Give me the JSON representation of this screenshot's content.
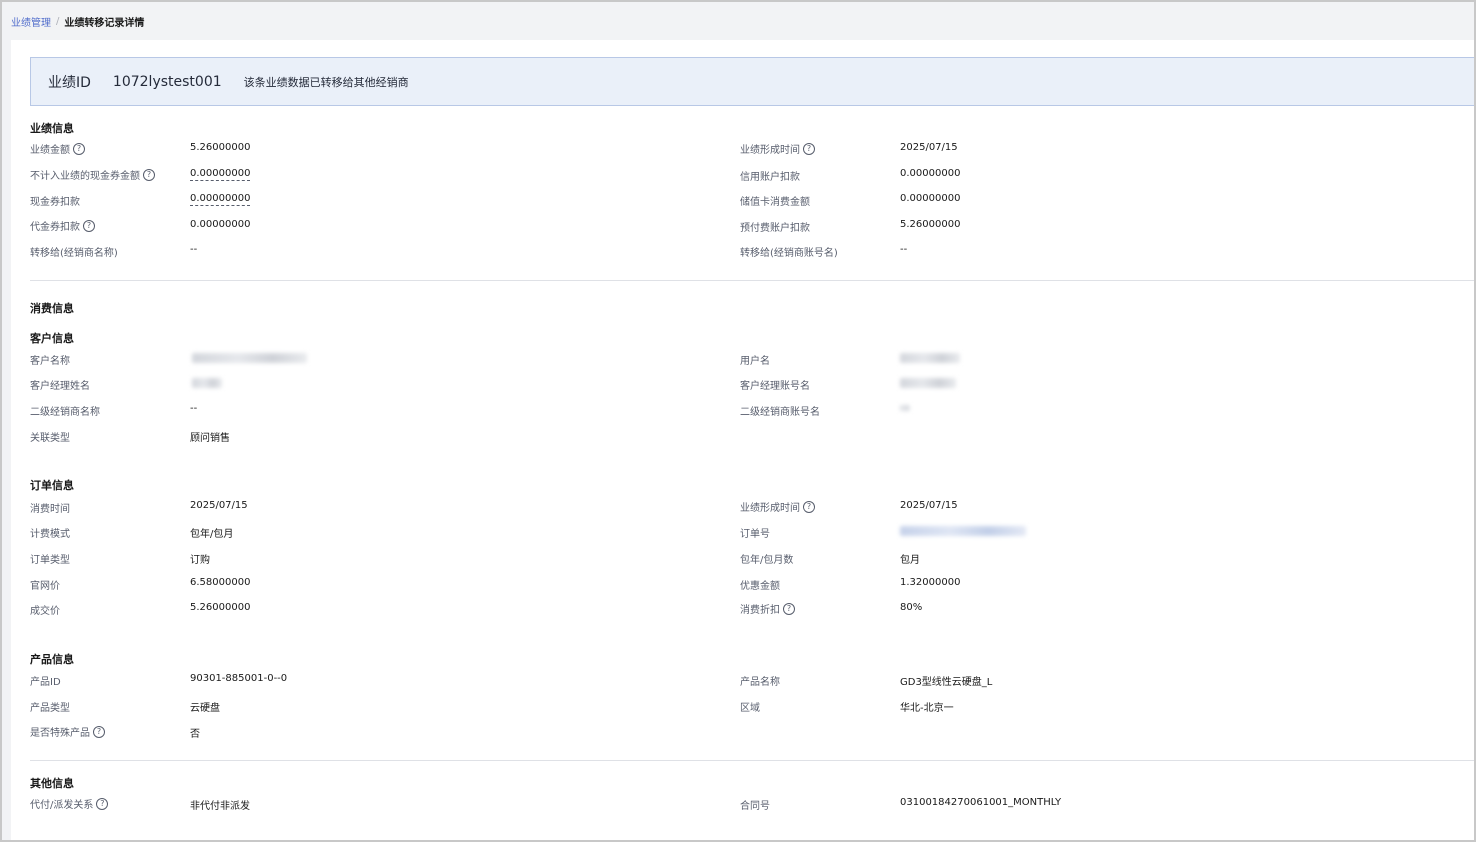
{
  "breadcrumb": {
    "parent": "业绩管理",
    "separator": "/",
    "current": "业绩转移记录详情"
  },
  "banner": {
    "key": "业绩ID",
    "id": "1072lystest001",
    "note": "该条业绩数据已转移给其他经销商"
  },
  "perf": {
    "title": "业绩信息",
    "amount_label": "业绩金额",
    "amount_value": "5.26000000",
    "formed_label": "业绩形成时间",
    "formed_value": "2025/07/15",
    "excluded_label": "不计入业绩的现金券金额",
    "excluded_value": "0.00000000",
    "credit_label": "信用账户扣款",
    "credit_value": "0.00000000",
    "coupon_label": "现金券扣款",
    "coupon_value": "0.00000000",
    "stored_label": "储值卡消费金额",
    "stored_value": "0.00000000",
    "voucher_label": "代金券扣款",
    "voucher_value": "0.00000000",
    "prepaid_label": "预付费账户扣款",
    "prepaid_value": "5.26000000",
    "to_name_label": "转移给(经销商名称)",
    "to_name_value": "--",
    "to_acct_label": "转移给(经销商账号名)",
    "to_acct_value": "--"
  },
  "consume": {
    "title": "消费信息"
  },
  "customer": {
    "title": "客户信息",
    "name_label": "客户名称",
    "user_label": "用户名",
    "manager_label": "客户经理姓名",
    "manager_acct_label": "客户经理账号名",
    "sub_name_label": "二级经销商名称",
    "sub_name_value": "--",
    "sub_acct_label": "二级经销商账号名",
    "rel_label": "关联类型",
    "rel_value": "顾问销售"
  },
  "order": {
    "title": "订单信息",
    "time_label": "消费时间",
    "time_value": "2025/07/15",
    "formed_label": "业绩形成时间",
    "formed_value": "2025/07/15",
    "billing_label": "计费模式",
    "billing_value": "包年/包月",
    "no_label": "订单号",
    "type_label": "订单类型",
    "type_value": "订购",
    "period_label": "包年/包月数",
    "period_value": "包月",
    "list_label": "官网价",
    "list_value": "6.58000000",
    "discount_amt_label": "优惠金额",
    "discount_amt_value": "1.32000000",
    "deal_label": "成交价",
    "deal_value": "5.26000000",
    "discount_label": "消费折扣",
    "discount_value": "80%"
  },
  "product": {
    "title": "产品信息",
    "id_label": "产品ID",
    "id_value": "90301-885001-0--0",
    "name_label": "产品名称",
    "name_value": "GD3型线性云硬盘_L",
    "type_label": "产品类型",
    "type_value": "云硬盘",
    "region_label": "区域",
    "region_value": "华北-北京一",
    "special_label": "是否特殊产品",
    "special_value": "否"
  },
  "other": {
    "title": "其他信息",
    "relation_label": "代付/派发关系",
    "relation_value": "非代付非派发",
    "contract_label": "合同号",
    "contract_value": "03100184270061001_MONTHLY"
  },
  "icons": {
    "help": "?"
  }
}
